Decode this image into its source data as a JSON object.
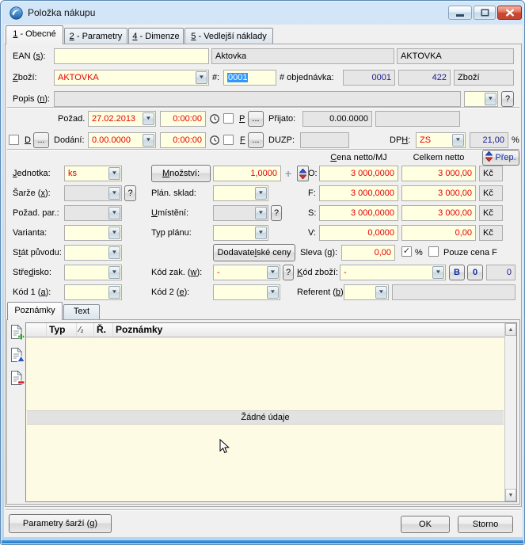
{
  "icons": {
    "dropdown": "▼",
    "help": "?",
    "dots": "...",
    "plus": "+",
    "scroll_up": "▲",
    "scroll_down": "▼",
    "check": "✓"
  },
  "window": {
    "title": "Položka nákupu"
  },
  "tabs": [
    {
      "label": "1 - Obecné",
      "key": "1"
    },
    {
      "label": "2 - Parametry",
      "key": "2"
    },
    {
      "label": "4 - Dimenze",
      "key": "4"
    },
    {
      "label": "5 - Vedlejší náklady",
      "key": "5"
    }
  ],
  "row_ean": {
    "label": "EAN (s):",
    "key": "s",
    "value": "",
    "name": "Aktovka",
    "code": "AKTOVKA"
  },
  "row_zbozi": {
    "label": "Zboží:",
    "key": "Z",
    "value": "AKTOVKA",
    "hash_label": "#:",
    "hash_value": "0001",
    "order_label": "# objednávka:",
    "order_value": "0001",
    "order_count": "422",
    "order_type": "Zboží"
  },
  "row_popis": {
    "label": "Popis (n):",
    "key": "n",
    "value": "",
    "combo_value": ""
  },
  "row_pozad": {
    "label": "Požad.",
    "date": "27.02.2013",
    "time": "0:00:00",
    "p_label": "P",
    "prijato_label": "Přijato:",
    "prijato_value": "0.00.0000",
    "prijato_extra": ""
  },
  "row_dodani": {
    "d_label": "D",
    "label": "Dodání:",
    "date": "0.00.0000",
    "time": "0:00:00",
    "f_label": "F",
    "duzp_label": "DUZP:",
    "duzp_value": "",
    "dph_label": "DPH:",
    "dph_key": "H",
    "dph_value": "ZS",
    "dph_rate": "21,00",
    "percent": "%"
  },
  "price_section": {
    "col_unit": "Cena netto/MJ",
    "col_unit_key": "C",
    "col_total": "Celkem netto",
    "prep_label": "Přep.",
    "rows": [
      {
        "label": "O:",
        "unit": "3 000,0000",
        "total": "3 000,00",
        "currency": "Kč"
      },
      {
        "label": "F:",
        "unit": "3 000,0000",
        "total": "3 000,00",
        "currency": "Kč"
      },
      {
        "label": "S:",
        "unit": "3 000,0000",
        "total": "3 000,00",
        "currency": "Kč"
      },
      {
        "label": "V:",
        "unit": "0,0000",
        "total": "0,00",
        "currency": "Kč"
      }
    ]
  },
  "row_jednotka": {
    "label": "Jednotka:",
    "key": "J",
    "value": "ks",
    "qty_button": "Množství:",
    "qty_key": "M",
    "qty": "1,0000"
  },
  "row_sarze": {
    "label": "Šarže (x):",
    "key": "x",
    "value": "",
    "mid_label": "Plán. sklad:",
    "mid_value": ""
  },
  "row_pozad_par": {
    "label": "Požad. par.:",
    "value": "",
    "mid_label": "Umístění:",
    "mid_key": "U",
    "mid_value": ""
  },
  "row_varianta": {
    "label": "Varianta:",
    "value": "",
    "mid_label": "Typ plánu:",
    "mid_value": ""
  },
  "row_stat": {
    "label": "Stát původu:",
    "key": "t",
    "value": "",
    "supplier_button": "Dodavatelské ceny",
    "supplier_key": "l",
    "sleva_label": "Sleva (g):",
    "sleva_key": "g",
    "sleva_value": "0,00",
    "percent": "%",
    "pouze_label": "Pouze cena F"
  },
  "row_stredisko": {
    "label": "Středisko:",
    "key": "d",
    "value": "",
    "kod_zak_label": "Kód zak. (w):",
    "kod_zak_key": "w",
    "kod_zak_value": "-",
    "kod_zbozi_label": "Kód zboží:",
    "kod_zbozi_key": "K",
    "kod_zbozi_value": "-",
    "b_button": "B",
    "zero_button": "0",
    "count": "0"
  },
  "row_kod1": {
    "label": "Kód 1 (a):",
    "key": "a",
    "value": "",
    "kod2_label": "Kód 2 (e):",
    "kod2_key": "e",
    "kod2_value": "",
    "referent_label": "Referent (b):",
    "referent_key": "b",
    "referent_value": "",
    "referent_extra": ""
  },
  "notes": {
    "tab_poznamky": "Poznámky",
    "tab_text": "Text",
    "col_typ": "Typ",
    "col_sort": "⁄₂",
    "col_r": "Ř.",
    "col_poznamky": "Poznámky",
    "empty_text": "Žádné údaje"
  },
  "footer": {
    "batch_button": "Parametry šarží (g)",
    "batch_key": "g",
    "ok": "OK",
    "storno": "Storno"
  },
  "colors": {
    "field_yellow": "#ffffe1",
    "readonly_gray": "#e6e6e6",
    "value_red": "#e80000",
    "value_navy": "#1a1a8c",
    "selection_blue": "#3297fd",
    "accent_blue_text": "#0a2ea0"
  }
}
